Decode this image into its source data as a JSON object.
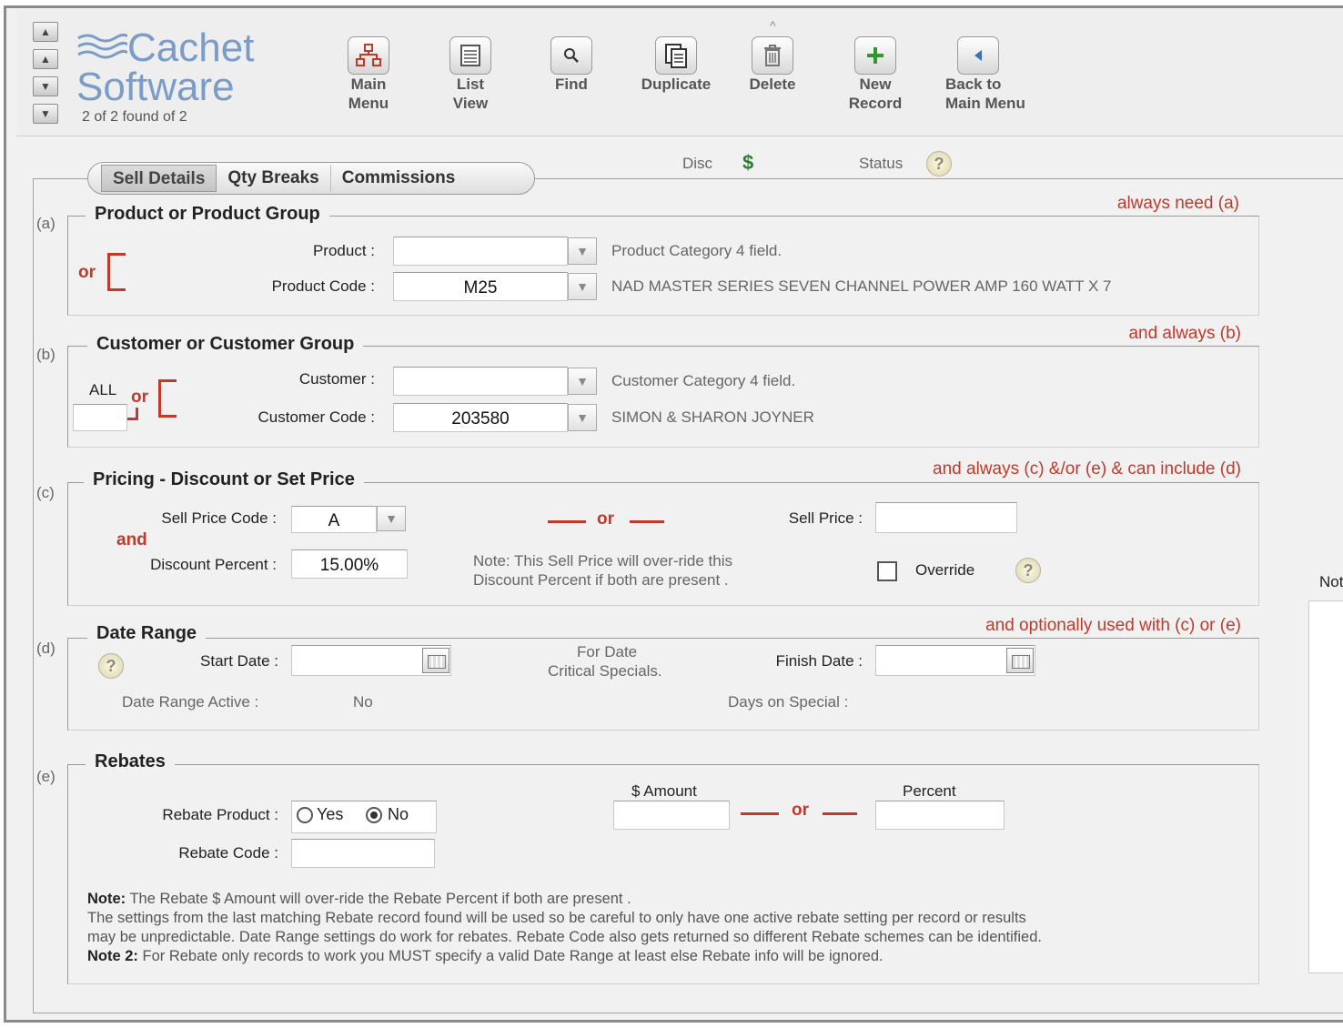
{
  "nav": {
    "first": "▲",
    "prev": "▲",
    "next": "▼",
    "last": "▼"
  },
  "logo": {
    "line1": "Cachet",
    "line2": "Software"
  },
  "found_text": "2 of 2 found of 2",
  "toolbar": {
    "main_menu": "Main\nMenu",
    "list_view": "List\nView",
    "find": "Find",
    "duplicate": "Duplicate",
    "delete": "Delete",
    "new_record": "New\nRecord",
    "back": "Back to\nMain Menu",
    "delete_caret": "^"
  },
  "tabs": [
    "Sell Details",
    "Qty Breaks",
    "Commissions"
  ],
  "header_labels": {
    "disc": "Disc",
    "status": "Status"
  },
  "section_a": {
    "letter": "(a)",
    "title": "Product or Product Group",
    "note": "always need (a)",
    "or": "or",
    "product_label": "Product  :",
    "product_value": "",
    "product_desc": "Product Category 4 field.",
    "code_label": "Product Code :",
    "code_value": "M25",
    "code_desc": "NAD MASTER SERIES SEVEN CHANNEL POWER AMP 160 WATT X 7"
  },
  "section_b": {
    "letter": "(b)",
    "title": "Customer or Customer Group",
    "note": "and always (b)",
    "all_label": "ALL",
    "or": "or",
    "customer_label": "Customer  :",
    "customer_value": "",
    "customer_desc": "Customer Category 4 field.",
    "code_label": "Customer Code :",
    "code_value": "203580",
    "code_desc": "SIMON & SHARON JOYNER"
  },
  "section_c": {
    "letter": "(c)",
    "title": "Pricing - Discount or Set Price",
    "note": "and always (c) &/or (e) & can include (d)",
    "sell_price_code_label": "Sell Price Code :",
    "sell_price_code_value": "A",
    "and": "and",
    "discount_label": "Discount Percent :",
    "discount_value": "15.00%",
    "or": "or",
    "sell_price_label": "Sell Price :",
    "sell_price_value": "",
    "note_line1": "Note: This Sell Price will over-ride this",
    "note_line2": "Discount Percent if both are present .",
    "override_label": "Override"
  },
  "section_d": {
    "letter": "(d)",
    "title": "Date Range",
    "note": "and optionally used with (c) or (e)",
    "start_label": "Start Date :",
    "start_value": "",
    "for_date_line1": "For Date",
    "for_date_line2": "Critical Specials.",
    "finish_label": "Finish Date :",
    "finish_value": "",
    "active_label": "Date Range Active :",
    "active_value": "No",
    "days_label": "Days on Special :"
  },
  "section_e": {
    "letter": "(e)",
    "title": "Rebates",
    "rebate_product_label": "Rebate Product :",
    "yes": "Yes",
    "no": "No",
    "rebate_code_label": "Rebate Code :",
    "amount_label": "$ Amount",
    "or": "or",
    "percent_label": "Percent",
    "note_bold": "Note:",
    "note_text": " The Rebate $ Amount will over-ride the Rebate Percent if both are present .",
    "note_line2": "The settings from the last matching Rebate record found will be used so be careful to only have one active rebate setting per record or results",
    "note_line3": "may be unpredictable.  Date Range settings do work for rebates.  Rebate Code also gets returned so different Rebate schemes can be identified.",
    "note2_bold": "Note 2:",
    "note2_text": " For Rebate only records to work you MUST specify a valid Date Range at least else Rebate info will be ignored."
  },
  "side_label": "Not",
  "colors": {
    "accent_red": "#c0392b",
    "logo_blue": "#7a9cc8",
    "disc_green": "#2e7d32"
  }
}
